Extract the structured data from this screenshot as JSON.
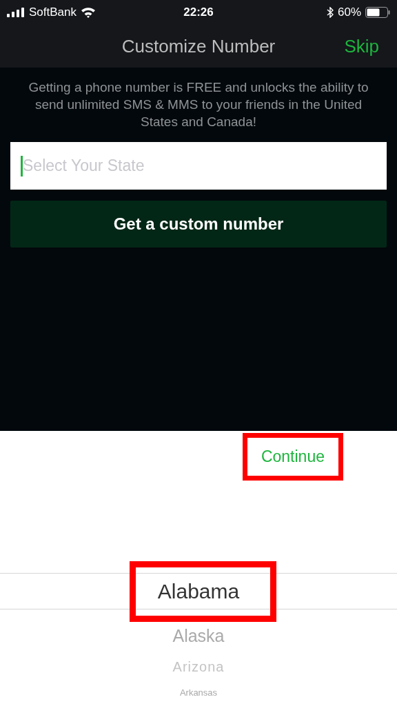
{
  "status_bar": {
    "carrier": "SoftBank",
    "time": "22:26",
    "battery": "60%"
  },
  "nav": {
    "title": "Customize Number",
    "action": "Skip"
  },
  "intro": "Getting a phone number is FREE and unlocks the ability to send unlimited SMS & MMS to your friends in the United States and Canada!",
  "state_field": {
    "placeholder": "Select Your State",
    "focused": true
  },
  "primary_button": "Get a custom number",
  "picker_toolbar": {
    "action": "Continue",
    "highlighted": true
  },
  "picker": {
    "highlighted": true,
    "items": [
      {
        "label": "Alabama",
        "selected": true
      },
      {
        "label": "Alaska",
        "selected": false
      },
      {
        "label": "Arizona",
        "selected": false
      },
      {
        "label": "Arkansas",
        "selected": false
      }
    ]
  }
}
